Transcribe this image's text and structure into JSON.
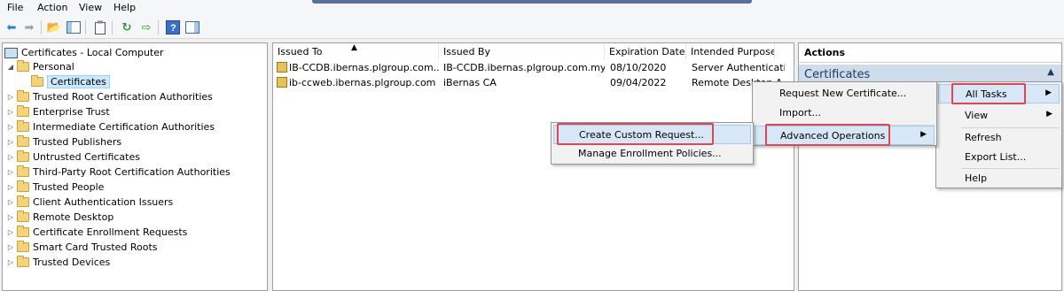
{
  "menubar": {
    "items": [
      "File",
      "Action",
      "View",
      "Help"
    ]
  },
  "toolbar": {
    "icons": [
      "back-arrow-icon",
      "forward-arrow-icon",
      "up-folder-icon",
      "show-tree-icon",
      "properties-icon",
      "refresh-icon",
      "export-icon",
      "help-icon",
      "show-action-pane-icon"
    ]
  },
  "tree": {
    "root": "Certificates - Local Computer",
    "personal": "Personal",
    "certificates": "Certificates",
    "items": [
      "Trusted Root Certification Authorities",
      "Enterprise Trust",
      "Intermediate Certification Authorities",
      "Trusted Publishers",
      "Untrusted Certificates",
      "Third-Party Root Certification Authorities",
      "Trusted People",
      "Client Authentication Issuers",
      "Remote Desktop",
      "Certificate Enrollment Requests",
      "Smart Card Trusted Roots",
      "Trusted Devices"
    ]
  },
  "list": {
    "columns": [
      "Issued To",
      "Issued By",
      "Expiration Date",
      "Intended Purposes"
    ],
    "rows": [
      [
        "IB-CCDB.ibernas.plgroup.com....",
        "IB-CCDB.ibernas.plgroup.com.my",
        "08/10/2020",
        "Server Authenticati..."
      ],
      [
        "ib-ccweb.ibernas.plgroup.com",
        "iBernas CA",
        "09/04/2022",
        "Remote Desktop A..."
      ]
    ]
  },
  "actions": {
    "header": "Actions",
    "section": "Certificates"
  },
  "menu_main": {
    "all_tasks": "All Tasks",
    "view": "View",
    "refresh": "Refresh",
    "export_list": "Export List...",
    "help": "Help"
  },
  "menu_alltasks": {
    "request_new": "Request New Certificate...",
    "import": "Import...",
    "advanced": "Advanced Operations"
  },
  "menu_advanced": {
    "create_custom": "Create Custom Request...",
    "manage_enrollment": "Manage Enrollment Policies..."
  },
  "colors": {
    "highlight_box": "#e0464f",
    "menu_highlight": "#d7e7f7",
    "actions_band": "#cfdcec"
  }
}
